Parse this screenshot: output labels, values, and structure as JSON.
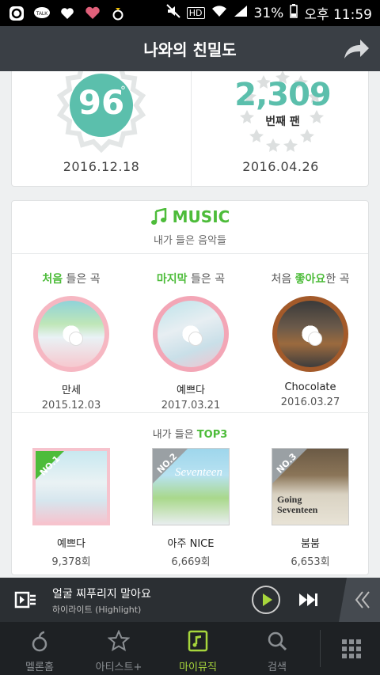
{
  "status_bar": {
    "battery": "31%",
    "time": "오후 11:59",
    "hd": "HD",
    "icons": [
      "g-app-icon",
      "kakaotalk-icon",
      "heart-icon",
      "heart-icon",
      "ring-icon",
      "mute-icon",
      "wifi-icon",
      "signal-icon"
    ]
  },
  "header": {
    "title": "나와의 친밀도",
    "share_icon": "share-arrow-icon"
  },
  "intimacy": {
    "temperature": "96",
    "degree": "°",
    "temperature_date": "2016.12.18",
    "fan_number": "2,309",
    "fan_label": "번째 팬",
    "fan_date": "2016.04.26"
  },
  "music": {
    "title": "MUSIC",
    "subtitle": "내가 들은 음악들",
    "first_played": {
      "highlight": "처음",
      "rest": " 들은 곡",
      "song": "만세",
      "date": "2015.12.03"
    },
    "last_played": {
      "highlight": "마지막",
      "rest": " 들은 곡",
      "song": "예쁘다",
      "date": "2017.03.21"
    },
    "first_liked": {
      "pre": "처음 ",
      "highlight": "좋아요",
      "rest": "한 곡",
      "song": "Chocolate",
      "date": "2016.03.27"
    },
    "top3_title": {
      "pre": "내가 들은 ",
      "highlight": "TOP3"
    },
    "top3": [
      {
        "rank": "NO.1",
        "song": "예쁘다",
        "count": "9,378회"
      },
      {
        "rank": "NO.2",
        "song": "아주 NICE",
        "count": "6,669회",
        "album_text": "Seventeen"
      },
      {
        "rank": "NO.3",
        "song": "붐붐",
        "count": "6,653회",
        "album_text": "Going Seventeen"
      }
    ]
  },
  "player": {
    "song": "얼굴 찌푸리지 말아요",
    "artist": "하이라이트 (Highlight)"
  },
  "nav": [
    {
      "label": "멜론홈",
      "icon": "melon-home-icon"
    },
    {
      "label": "아티스트+",
      "icon": "star-icon"
    },
    {
      "label": "마이뮤직",
      "icon": "my-music-icon"
    },
    {
      "label": "검색",
      "icon": "search-icon"
    }
  ],
  "colors": {
    "accent": "#4dbc3a",
    "teal": "#5bbfac",
    "header": "#3a3f45",
    "nav_active": "#a7d63c"
  }
}
